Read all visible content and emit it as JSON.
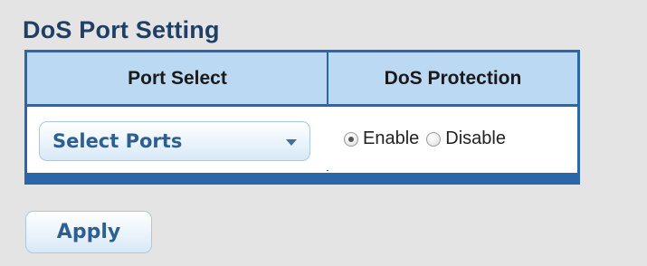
{
  "page": {
    "title": "DoS Port Setting"
  },
  "table": {
    "headers": {
      "port_select": "Port Select",
      "dos_protection": "DoS Protection"
    },
    "row": {
      "port_select": {
        "value": "Select Ports",
        "icon": "chevron-down-icon"
      },
      "dos_protection": {
        "options": [
          "Enable",
          "Disable"
        ],
        "selected": "Enable"
      }
    }
  },
  "actions": {
    "apply_label": "Apply"
  },
  "colors": {
    "background": "#e4e4e4",
    "title": "#1f3f66",
    "table_border": "#2b67a8",
    "header_bg": "#bcd9f3",
    "button_text": "#2d5f91"
  }
}
